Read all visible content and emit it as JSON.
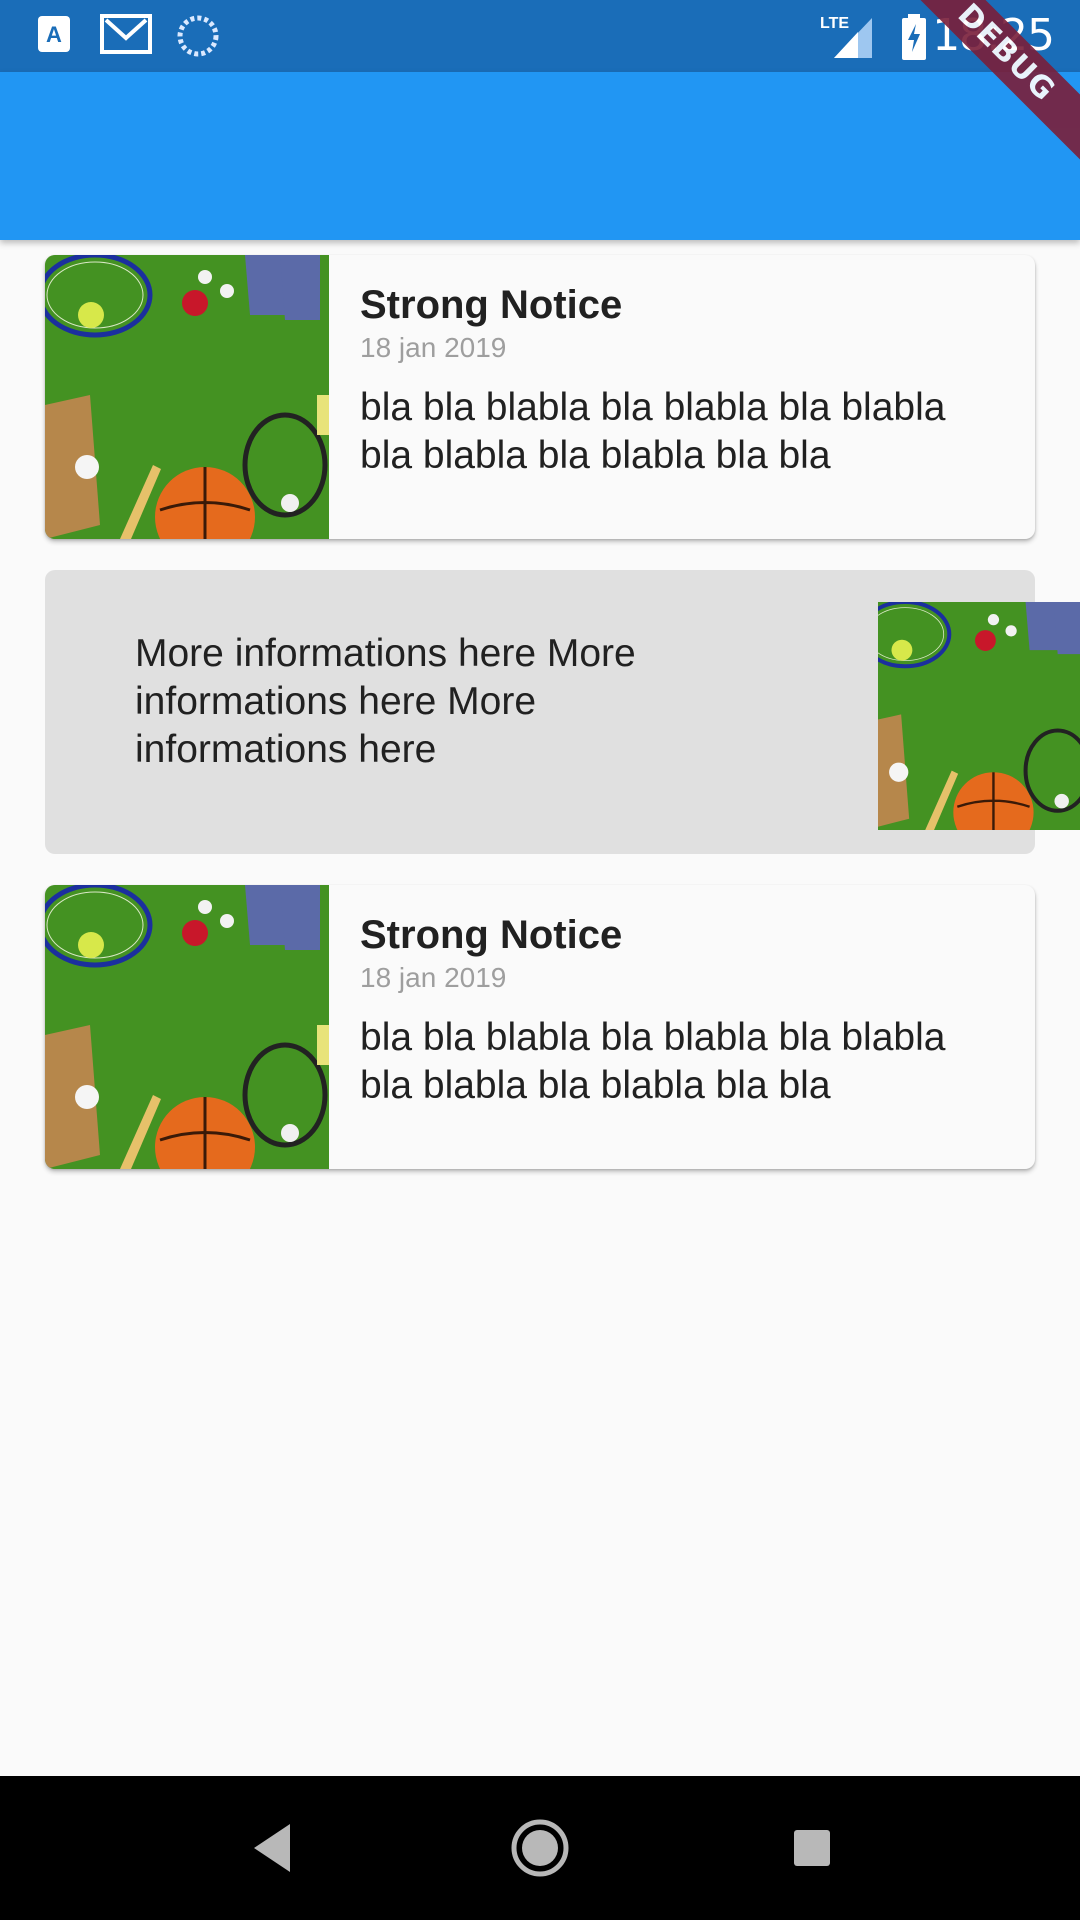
{
  "status_bar": {
    "time": "18:25",
    "network": "LTE",
    "icons": [
      "accessibility-icon",
      "gmail-icon",
      "sync-icon",
      "signal-icon",
      "battery-charging-icon"
    ]
  },
  "debug_banner": "DEBUG",
  "cards": [
    {
      "title": "Strong Notice",
      "date": "18 jan 2019",
      "text": "bla bla blabla bla blabla bla blabla bla blabla bla blabla bla bla",
      "image": "sports-equipment-image"
    },
    {
      "title": "Strong Notice",
      "date": "18 jan 2019",
      "text": "bla bla blabla bla blabla bla blabla bla blabla bla blabla bla bla",
      "image": "sports-equipment-image"
    }
  ],
  "info_card": {
    "text": "More informations here  More informations here More informations here",
    "image": "sports-equipment-image"
  },
  "nav_bar": {
    "buttons": [
      "back-icon",
      "home-icon",
      "recents-icon"
    ]
  }
}
